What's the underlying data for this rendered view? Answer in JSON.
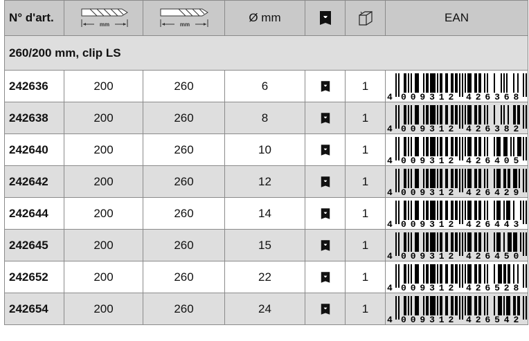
{
  "header": {
    "art_label": "N° d'art.",
    "drill_small_unit": "mm",
    "drill_large_unit": "mm",
    "diameter_label": "Ø mm",
    "clip_icon": "clip-pack-icon",
    "box_icon": "box-quantity-icon",
    "ean_label": "EAN"
  },
  "group": {
    "title": "260/200 mm, clip LS"
  },
  "rows": [
    {
      "art": "242636",
      "working_length": "200",
      "total_length": "260",
      "diameter": "6",
      "qty": "1",
      "ean_digits": [
        "4",
        "009312",
        "426368"
      ]
    },
    {
      "art": "242638",
      "working_length": "200",
      "total_length": "260",
      "diameter": "8",
      "qty": "1",
      "ean_digits": [
        "4",
        "009312",
        "426382"
      ]
    },
    {
      "art": "242640",
      "working_length": "200",
      "total_length": "260",
      "diameter": "10",
      "qty": "1",
      "ean_digits": [
        "4",
        "009312",
        "426405"
      ]
    },
    {
      "art": "242642",
      "working_length": "200",
      "total_length": "260",
      "diameter": "12",
      "qty": "1",
      "ean_digits": [
        "4",
        "009312",
        "426429"
      ]
    },
    {
      "art": "242644",
      "working_length": "200",
      "total_length": "260",
      "diameter": "14",
      "qty": "1",
      "ean_digits": [
        "4",
        "009312",
        "426443"
      ]
    },
    {
      "art": "242645",
      "working_length": "200",
      "total_length": "260",
      "diameter": "15",
      "qty": "1",
      "ean_digits": [
        "4",
        "009312",
        "426450"
      ]
    },
    {
      "art": "242652",
      "working_length": "200",
      "total_length": "260",
      "diameter": "22",
      "qty": "1",
      "ean_digits": [
        "4",
        "009312",
        "426528"
      ]
    },
    {
      "art": "242654",
      "working_length": "200",
      "total_length": "260",
      "diameter": "24",
      "qty": "1",
      "ean_digits": [
        "4",
        "009312",
        "426542"
      ]
    }
  ]
}
